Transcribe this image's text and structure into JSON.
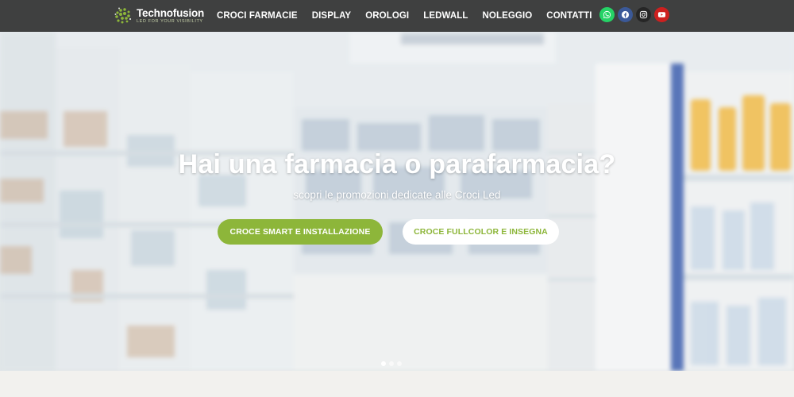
{
  "brand": {
    "name": "Technofusion",
    "tagline": "LED FOR YOUR VISIBILITY",
    "accent": "#8db63a"
  },
  "nav": {
    "items": [
      {
        "label": "CROCI FARMACIE"
      },
      {
        "label": "DISPLAY"
      },
      {
        "label": "OROLOGI"
      },
      {
        "label": "LEDWALL"
      },
      {
        "label": "NOLEGGIO"
      },
      {
        "label": "CONTATTI"
      }
    ]
  },
  "social": [
    {
      "icon": "whatsapp-icon",
      "color": "#25d366"
    },
    {
      "icon": "facebook-icon",
      "color": "#3b5998"
    },
    {
      "icon": "instagram-icon",
      "color": "#262626"
    },
    {
      "icon": "youtube-icon",
      "color": "#cd201f"
    }
  ],
  "hero": {
    "title": "Hai una farmacia o parafarmacia?",
    "subtitle": "scopri le promozioni dedicate alle Croci Led",
    "primary_button": "CROCE SMART E INSTALLAZIONE",
    "secondary_button": "CROCE FULLCOLOR E INSEGNA",
    "slides_total": 3,
    "active_slide": 1
  }
}
